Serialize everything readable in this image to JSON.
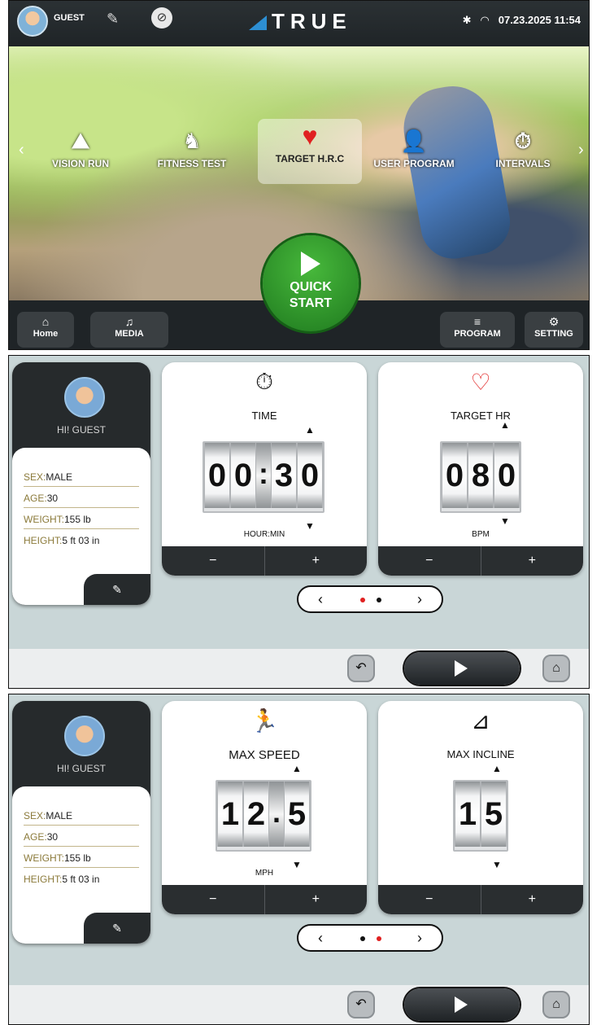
{
  "header": {
    "user": "GUEST",
    "brand": "TRUE",
    "datetime": "07.23.2025 11:54",
    "bluetooth_icon": "✱",
    "wifi_icon": "◠"
  },
  "programs": [
    {
      "label": "VISION RUN",
      "icon": "⛰"
    },
    {
      "label": "FITNESS TEST",
      "icon": "♞"
    },
    {
      "label": "TARGET H.R.C",
      "icon": "♥"
    },
    {
      "label": "USER PROGRAM",
      "icon": "👤"
    },
    {
      "label": "INTERVALS",
      "icon": "⏱"
    }
  ],
  "quick_start": {
    "line1": "QUICK",
    "line2": "START"
  },
  "bottom_nav": {
    "home": "Home",
    "media": "MEDIA",
    "program": "PROGRAM",
    "setting": "SETTING"
  },
  "profile": {
    "greeting": "HI! GUEST",
    "sex_key": "SEX:",
    "sex": "MALE",
    "age_key": "AGE:",
    "age": "30",
    "weight_key": "WEIGHT:",
    "weight": "155 lb",
    "height_key": "HEIGHT:",
    "height": "5 ft 03 in"
  },
  "screen1": {
    "time": {
      "title": "TIME",
      "digits": [
        "0",
        "0",
        ":",
        "3",
        "0"
      ],
      "unit": "HOUR:MIN"
    },
    "target_hr": {
      "title": "TARGET HR",
      "digits": [
        "0",
        "8",
        "0"
      ],
      "unit": "BPM"
    },
    "active_page": 1
  },
  "screen2": {
    "max_speed": {
      "title": "MAX SPEED",
      "digits": [
        "1",
        "2",
        ".",
        "5"
      ],
      "unit": "MPH"
    },
    "max_incline": {
      "title": "MAX INCLINE",
      "digits": [
        "1",
        "5"
      ],
      "unit": ""
    },
    "active_page": 2
  },
  "controls": {
    "minus": "−",
    "plus": "+",
    "prev": "‹",
    "next": "›",
    "up": "▲",
    "down": "▼"
  },
  "colors": {
    "accent_red": "#e02020",
    "start_green": "#2f9a2a",
    "brand_blue": "#2d8fd3"
  }
}
